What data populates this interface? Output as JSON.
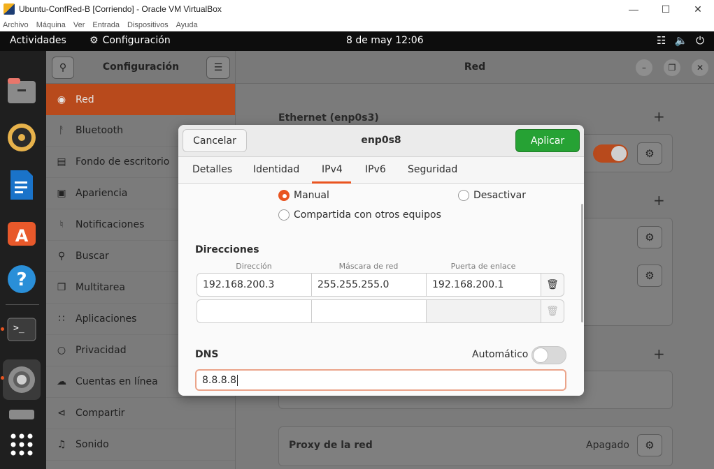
{
  "host": {
    "window_title": "Ubuntu-ConfRed-B [Corriendo] - Oracle VM VirtualBox",
    "menu": [
      "Archivo",
      "Máquina",
      "Ver",
      "Entrada",
      "Dispositivos",
      "Ayuda"
    ]
  },
  "topbar": {
    "activities": "Actividades",
    "app_name": "Configuración",
    "clock": "8 de may  12:06"
  },
  "sidebar": {
    "title": "Configuración",
    "items": [
      {
        "label": "Red",
        "icon": "globe-icon"
      },
      {
        "label": "Bluetooth",
        "icon": "bluetooth-icon"
      },
      {
        "label": "Fondo de escritorio",
        "icon": "monitor-icon"
      },
      {
        "label": "Apariencia",
        "icon": "appearance-icon"
      },
      {
        "label": "Notificaciones",
        "icon": "bell-icon"
      },
      {
        "label": "Buscar",
        "icon": "search-icon"
      },
      {
        "label": "Multitarea",
        "icon": "multitask-icon"
      },
      {
        "label": "Aplicaciones",
        "icon": "apps-grid-icon"
      },
      {
        "label": "Privacidad",
        "icon": "lock-icon"
      },
      {
        "label": "Cuentas en línea",
        "icon": "cloud-icon"
      },
      {
        "label": "Compartir",
        "icon": "share-icon"
      },
      {
        "label": "Sonido",
        "icon": "music-note-icon"
      }
    ]
  },
  "main": {
    "title": "Red",
    "ethernet_title": "Ethernet (enp0s3)",
    "proxy_label": "Proxy de la red",
    "proxy_status": "Apagado"
  },
  "dialog": {
    "title": "enp0s8",
    "cancel": "Cancelar",
    "apply": "Aplicar",
    "tabs": [
      "Detalles",
      "Identidad",
      "IPv4",
      "IPv6",
      "Seguridad"
    ],
    "active_tab": "IPv4",
    "methods": {
      "manual": "Manual",
      "disable": "Desactivar",
      "shared": "Compartida con otros equipos"
    },
    "addresses": {
      "title": "Direcciones",
      "col_address": "Dirección",
      "col_mask": "Máscara de red",
      "col_gateway": "Puerta de enlace",
      "row1": {
        "address": "192.168.200.3",
        "mask": "255.255.255.0",
        "gateway": "192.168.200.1"
      },
      "row2": {
        "address": "",
        "mask": "",
        "gateway": ""
      }
    },
    "dns": {
      "title": "DNS",
      "auto_label": "Automático",
      "value": "8.8.8.8"
    }
  },
  "colors": {
    "accent": "#e95420",
    "apply_green": "#26a234",
    "active_sidebar": "#b84a1c"
  }
}
